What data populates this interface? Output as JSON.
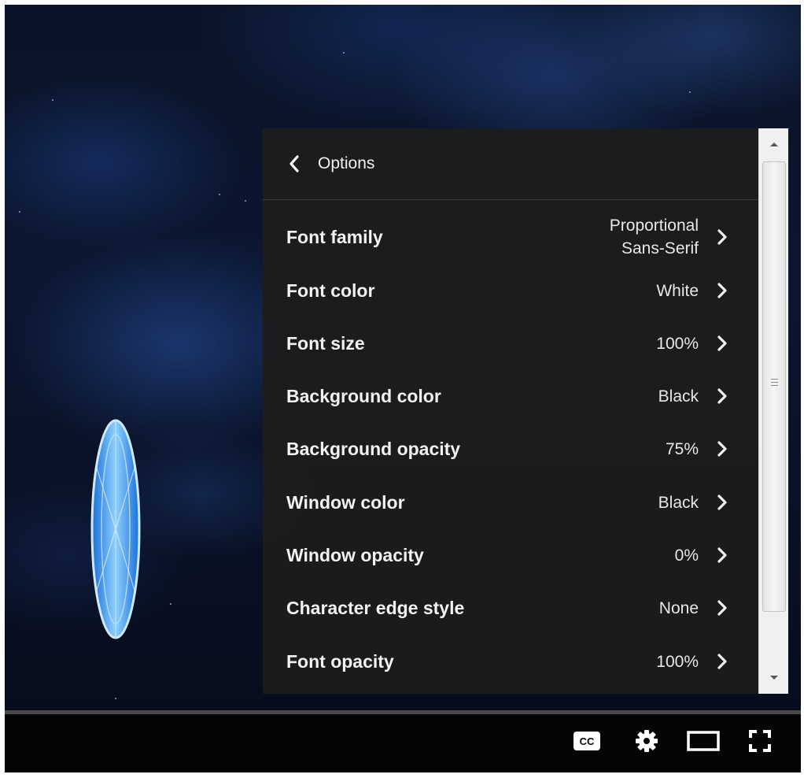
{
  "panel": {
    "title": "Options",
    "back_icon": "chevron-left-icon"
  },
  "options": [
    {
      "label": "Font family",
      "value_lines": [
        "Proportional",
        "Sans-Serif"
      ]
    },
    {
      "label": "Font color",
      "value_lines": [
        "White"
      ]
    },
    {
      "label": "Font size",
      "value_lines": [
        "100%"
      ]
    },
    {
      "label": "Background color",
      "value_lines": [
        "Black"
      ]
    },
    {
      "label": "Background opacity",
      "value_lines": [
        "75%"
      ]
    },
    {
      "label": "Window color",
      "value_lines": [
        "Black"
      ]
    },
    {
      "label": "Window opacity",
      "value_lines": [
        "0%"
      ]
    },
    {
      "label": "Character edge style",
      "value_lines": [
        "None"
      ]
    },
    {
      "label": "Font opacity",
      "value_lines": [
        "100%"
      ]
    }
  ],
  "controls": {
    "captions_badge": "CC",
    "icons": [
      "captions-icon",
      "settings-gear-icon",
      "theater-mode-icon",
      "fullscreen-icon"
    ]
  },
  "colors": {
    "panel_bg": "#1c1c1c",
    "text": "#eeeeee",
    "controls_bg": "#050505"
  }
}
